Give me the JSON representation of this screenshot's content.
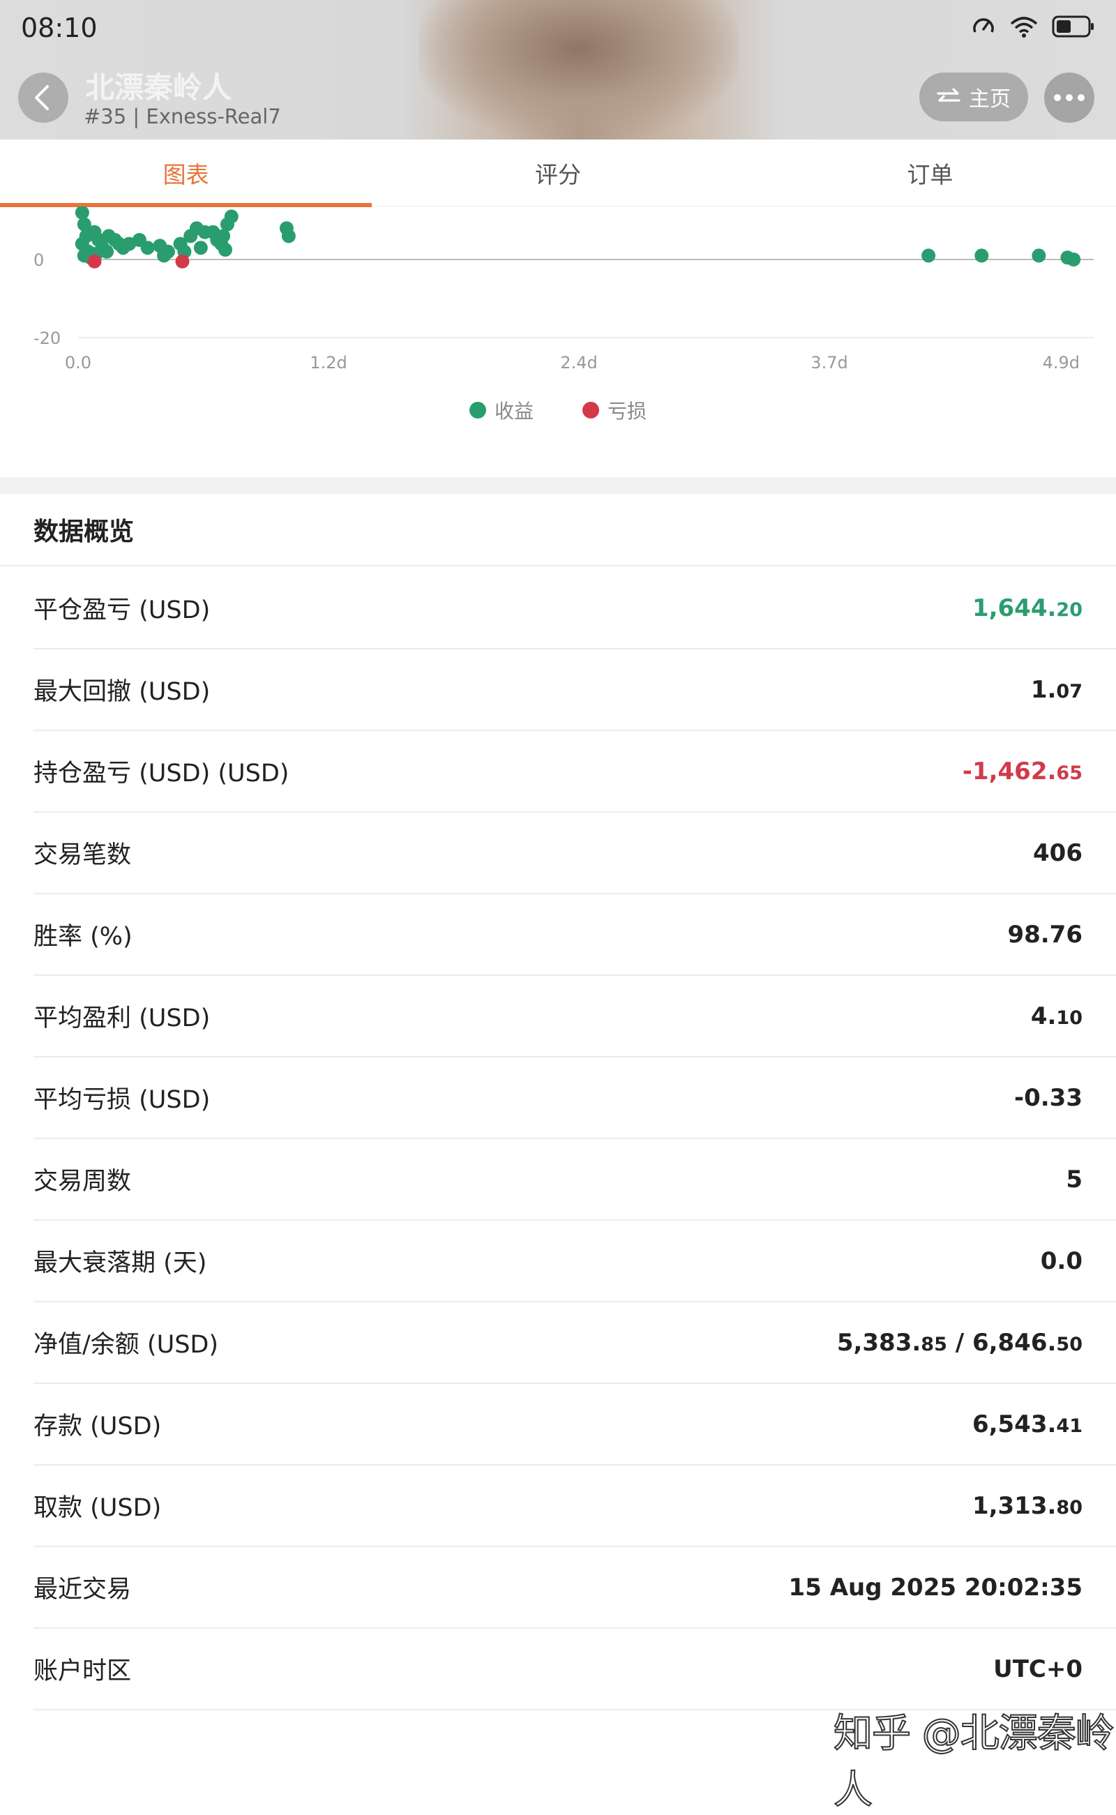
{
  "status_bar": {
    "time": "08:10"
  },
  "header": {
    "title": "北漂秦岭人",
    "subtitle": "#35 | Exness-Real7",
    "home_label": "主页"
  },
  "tabs": [
    {
      "label": "图表",
      "active": true
    },
    {
      "label": "评分",
      "active": false
    },
    {
      "label": "订单",
      "active": false
    }
  ],
  "chart_data": {
    "type": "scatter",
    "x_unit": "days",
    "y_ticks": [
      "0",
      "-20"
    ],
    "x_ticks": [
      "0.0",
      "1.2d",
      "2.4d",
      "3.7d",
      "4.9d"
    ],
    "xlim": [
      0,
      4.9
    ],
    "ylim": [
      -20,
      13
    ],
    "series": [
      {
        "name": "收益",
        "color": "#2a9d6f",
        "points": [
          [
            0.02,
            12
          ],
          [
            0.03,
            9
          ],
          [
            0.04,
            6
          ],
          [
            0.02,
            4
          ],
          [
            0.05,
            2
          ],
          [
            0.03,
            1
          ],
          [
            0.06,
            0.5
          ],
          [
            0.08,
            7
          ],
          [
            0.1,
            5
          ],
          [
            0.12,
            3
          ],
          [
            0.09,
            1.5
          ],
          [
            0.15,
            6
          ],
          [
            0.14,
            2
          ],
          [
            0.18,
            5
          ],
          [
            0.2,
            4
          ],
          [
            0.22,
            3
          ],
          [
            0.25,
            4
          ],
          [
            0.3,
            5
          ],
          [
            0.34,
            3
          ],
          [
            0.4,
            3.5
          ],
          [
            0.44,
            2
          ],
          [
            0.42,
            1
          ],
          [
            0.5,
            4
          ],
          [
            0.55,
            6
          ],
          [
            0.6,
            3
          ],
          [
            0.52,
            2
          ],
          [
            0.58,
            8
          ],
          [
            0.62,
            7
          ],
          [
            0.66,
            7
          ],
          [
            0.68,
            5
          ],
          [
            0.72,
            2.5
          ],
          [
            0.7,
            4
          ],
          [
            0.71,
            6
          ],
          [
            0.73,
            9
          ],
          [
            0.75,
            11
          ],
          [
            1.02,
            8
          ],
          [
            1.03,
            6
          ],
          [
            4.16,
            1
          ],
          [
            4.42,
            1
          ],
          [
            4.7,
            1
          ],
          [
            4.84,
            0.5
          ],
          [
            4.87,
            0
          ]
        ]
      },
      {
        "name": "亏损",
        "color": "#d23a4a",
        "points": [
          [
            0.08,
            -0.5
          ],
          [
            0.51,
            -0.5
          ]
        ]
      }
    ]
  },
  "overview": {
    "title": "数据概览",
    "rows": [
      {
        "label": "平仓盈亏 (USD)",
        "main": "1,644.",
        "dec": "20",
        "tone": "pos"
      },
      {
        "label": "最大回撤 (USD)",
        "main": "1.",
        "dec": "07",
        "tone": ""
      },
      {
        "label": "持仓盈亏 (USD) (USD)",
        "main": "-1,462.",
        "dec": "65",
        "tone": "neg"
      },
      {
        "label": "交易笔数",
        "main": "406",
        "dec": "",
        "tone": ""
      },
      {
        "label": "胜率 (%)",
        "main": "98.76",
        "dec": "",
        "tone": ""
      },
      {
        "label": "平均盈利 (USD)",
        "main": "4.",
        "dec": "10",
        "tone": ""
      },
      {
        "label": "平均亏损 (USD)",
        "main": "-0.33",
        "dec": "",
        "tone": ""
      },
      {
        "label": "交易周数",
        "main": "5",
        "dec": "",
        "tone": ""
      },
      {
        "label": "最大衰落期 (天)",
        "main": "0.0",
        "dec": "",
        "tone": ""
      },
      {
        "label": "净值/余额 (USD)",
        "main": "5,383.",
        "dec": "85",
        "main2": " / 6,846.",
        "dec2": "50",
        "tone": ""
      },
      {
        "label": "存款 (USD)",
        "main": "6,543.",
        "dec": "41",
        "tone": ""
      },
      {
        "label": "取款 (USD)",
        "main": "1,313.",
        "dec": "80",
        "tone": ""
      },
      {
        "label": "最近交易",
        "main": "15 Aug 2025 20:02:35",
        "dec": "",
        "tone": ""
      },
      {
        "label": "账户时区",
        "main": "UTC+0",
        "dec": "",
        "tone": ""
      }
    ]
  },
  "watermark": "知乎 @北漂秦岭人"
}
